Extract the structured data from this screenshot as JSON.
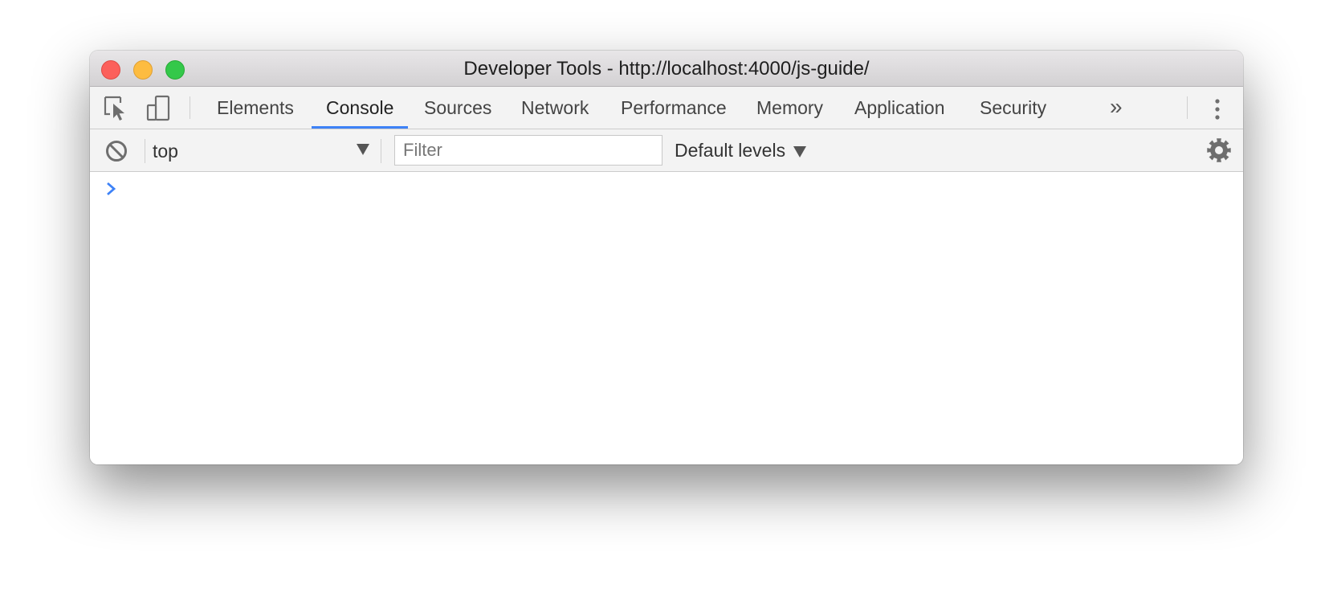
{
  "window": {
    "title": "Developer Tools - http://localhost:4000/js-guide/"
  },
  "toolbar": {
    "tabs": [
      {
        "label": "Elements",
        "active": false
      },
      {
        "label": "Console",
        "active": true
      },
      {
        "label": "Sources",
        "active": false
      },
      {
        "label": "Network",
        "active": false
      },
      {
        "label": "Performance",
        "active": false
      },
      {
        "label": "Memory",
        "active": false
      },
      {
        "label": "Application",
        "active": false
      },
      {
        "label": "Security",
        "active": false
      }
    ],
    "more_tabs_label": "»",
    "icons": {
      "inspect": "inspect-element-icon",
      "device": "device-toolbar-icon",
      "menu": "more-options-icon"
    }
  },
  "console_toolbar": {
    "context_value": "top",
    "filter_placeholder": "Filter",
    "filter_value": "",
    "levels_label": "Default levels",
    "icons": {
      "clear": "clear-console-icon",
      "settings": "gear-icon"
    }
  },
  "console": {
    "prompt_symbol": ">",
    "input_value": ""
  },
  "colors": {
    "accent": "#3e82f7",
    "prompt": "#3e82f7",
    "close": "#fc605b",
    "minimize": "#fdbc40",
    "zoom": "#34c84a"
  }
}
